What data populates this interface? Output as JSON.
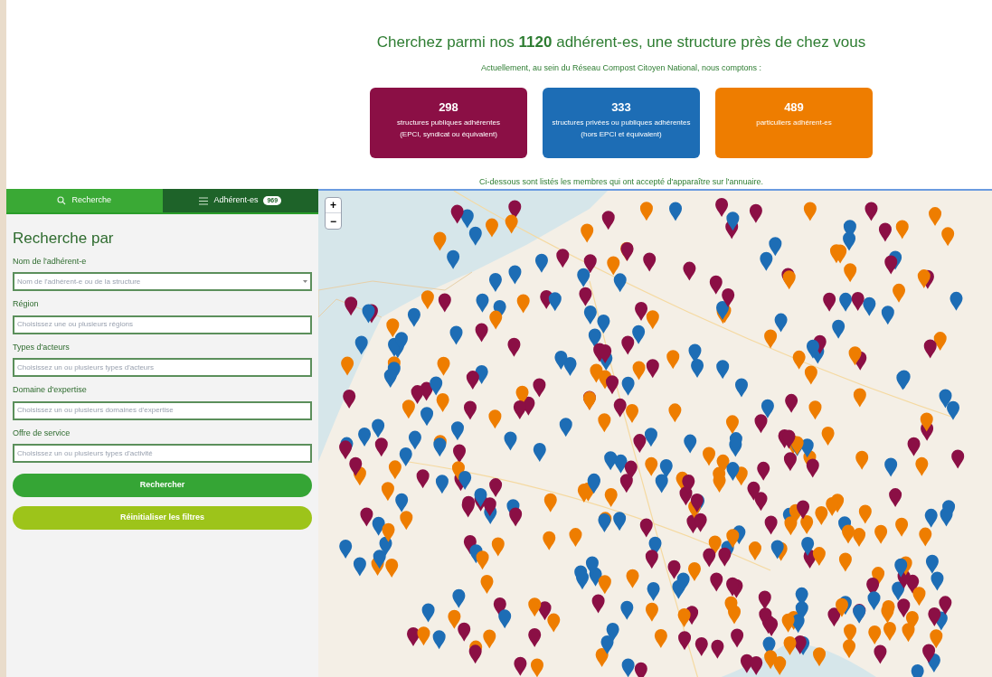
{
  "heading": "Cherchez parmi nos **1120** adhérent-es, une structure près de chez vous",
  "intro": "Actuellement, au sein du Réseau Compost Citoyen National, nous comptons :",
  "stats": [
    {
      "number": "298",
      "lines": [
        "structures publiques adhérentes",
        "(EPCI, syndicat ou équivalent)"
      ],
      "color": "#8b0f45"
    },
    {
      "number": "333",
      "lines": [
        "structures privées ou publiques adhérentes",
        "(hors EPCI et équivalent)"
      ],
      "color": "#1d6db5"
    },
    {
      "number": "489",
      "lines": [
        "particuliers adhérent-es"
      ],
      "color": "#ee7d00"
    }
  ],
  "note": "Ci-dessous sont listés les membres qui ont accepté d'apparaître sur l'annuaire.",
  "tabs": [
    {
      "kind": "search",
      "label": "Recherche",
      "selected": true
    },
    {
      "kind": "list",
      "label": "Adhérent-es",
      "badge": "969",
      "selected": false
    }
  ],
  "form": {
    "title": "Recherche par",
    "fields": [
      {
        "kind": "select",
        "label": "Nom de l'adhérent-e",
        "placeholder": "Nom de l'adhérent-e ou de la structure"
      },
      {
        "kind": "multi",
        "label": "Région",
        "placeholder": "Choisissez une ou plusieurs régions"
      },
      {
        "kind": "multi",
        "label": "Types d'acteurs",
        "placeholder": "Choisissez un ou plusieurs types d'acteurs"
      },
      {
        "kind": "multi",
        "label": "Domaine d'expertise",
        "placeholder": "Choisissez un ou plusieurs domaines d'expertise"
      },
      {
        "kind": "multi",
        "label": "Offre de service",
        "placeholder": "Choisissez un ou plusieurs types d'activité"
      }
    ],
    "buttons": [
      {
        "kind": "primary",
        "label": "Rechercher"
      },
      {
        "kind": "secondary",
        "label": "Réinitialiser les filtres"
      }
    ]
  },
  "map": {
    "zoom_buttons": [
      "+",
      "−"
    ]
  }
}
